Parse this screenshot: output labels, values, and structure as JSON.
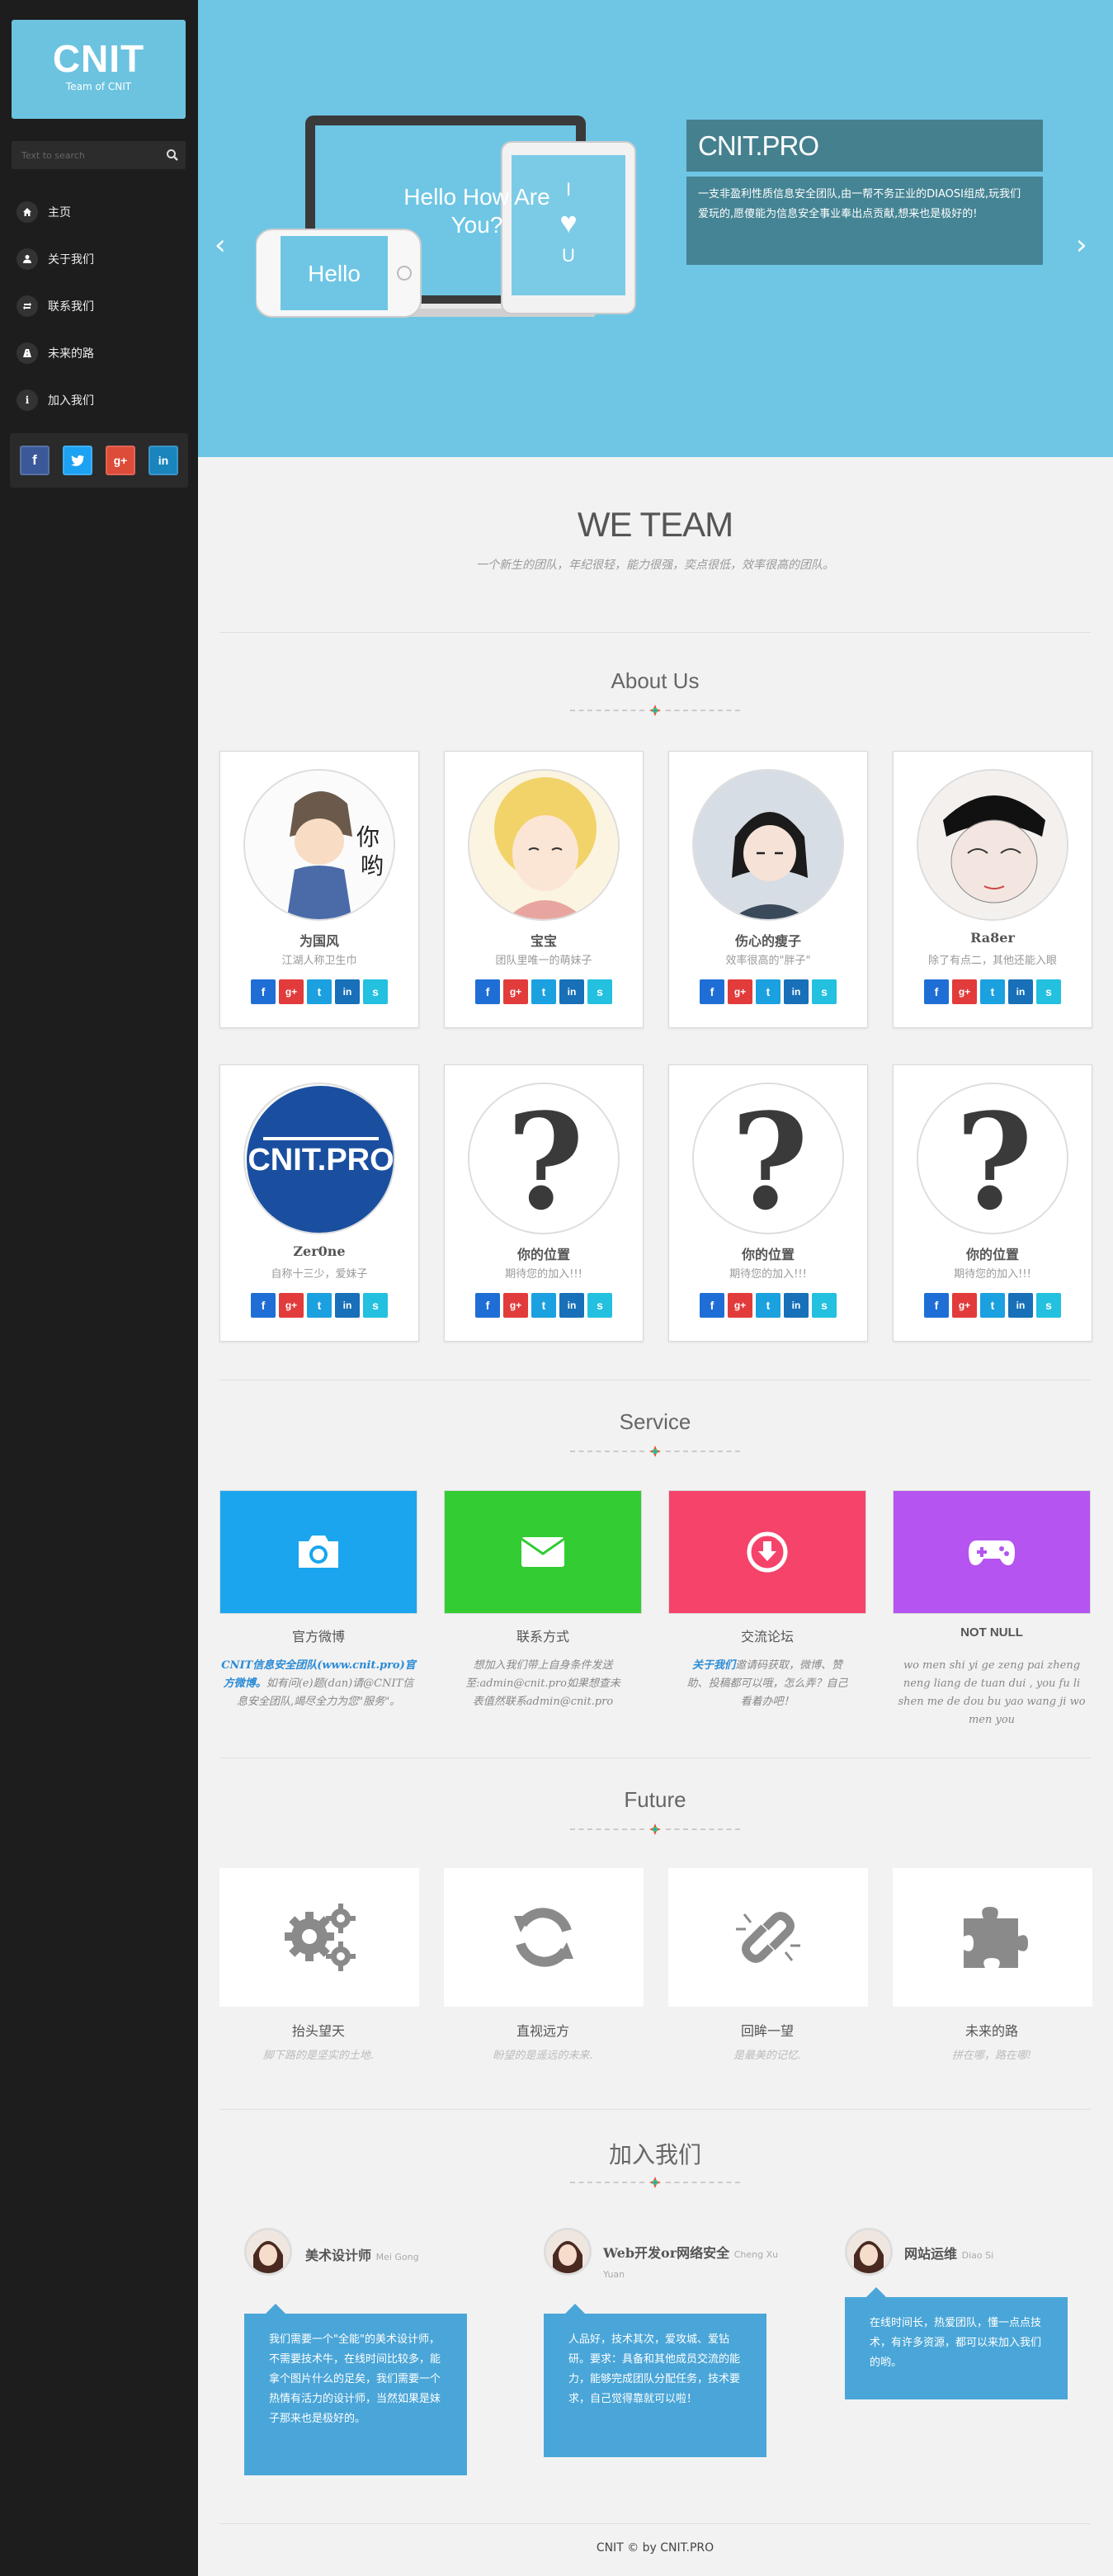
{
  "sidebar": {
    "logo_title": "CNIT",
    "logo_subtitle": "Team of CNIT",
    "search_placeholder": "Text to search",
    "nav": [
      {
        "label": "主页",
        "icon": "home-icon"
      },
      {
        "label": "关于我们",
        "icon": "user-icon"
      },
      {
        "label": "联系我们",
        "icon": "retweet-icon"
      },
      {
        "label": "未来的路",
        "icon": "road-icon"
      },
      {
        "label": "加入我们",
        "icon": "info-icon"
      }
    ],
    "social": [
      {
        "label": "f",
        "color": "#3b5998",
        "icon": "facebook-icon"
      },
      {
        "label": "t",
        "color": "#1da1f2",
        "icon": "twitter-icon"
      },
      {
        "label": "g+",
        "color": "#dd4b39",
        "icon": "google-plus-icon"
      },
      {
        "label": "in",
        "color": "#1a84bc",
        "icon": "linkedin-icon"
      }
    ]
  },
  "hero": {
    "prev_arrow": "‹",
    "next_arrow": "›",
    "laptop_text": "Hello How Are You?",
    "phone_text": "Hello",
    "tablet_lines": [
      "I",
      "♥",
      "U"
    ],
    "title": "CNIT.PRO",
    "text": "一支非盈利性质信息安全团队,由一帮不务正业的DIAOSI组成,玩我们爱玩的,愿傻能为信息安全事业奉出点贡献,想来也是极好的!"
  },
  "we_team": {
    "title": "WE TEAM",
    "subtitle": "一个新生的团队，年纪很轻，能力很强，奕点很低，效率很高的团队。"
  },
  "about": {
    "title": "About Us",
    "members": [
      {
        "name": "为国风",
        "desc": "江湖人称卫生巾",
        "avatar": "cartoon-swordsman-avatar"
      },
      {
        "name": "宝宝",
        "desc": "团队里唯一的萌妹子",
        "avatar": "blonde-girl-avatar"
      },
      {
        "name": "伤心的瘦子",
        "desc": "效率很高的\"胖子\"",
        "avatar": "cartoon-boy-avatar"
      },
      {
        "name": "Ra8er",
        "desc": "除了有点二，其他还能入眼",
        "avatar": "sketch-face-avatar"
      },
      {
        "name": "Zer0ne",
        "desc": "自称十三少，爱妹子",
        "avatar": "cnit-logo-avatar"
      },
      {
        "name": "你的位置",
        "desc": "期待您的加入!!!",
        "avatar": "question-mark-avatar"
      },
      {
        "name": "你的位置",
        "desc": "期待您的加入!!!",
        "avatar": "question-mark-avatar"
      },
      {
        "name": "你的位置",
        "desc": "期待您的加入!!!",
        "avatar": "question-mark-avatar"
      }
    ],
    "card_social": [
      {
        "label": "f",
        "color": "#1f6ed6"
      },
      {
        "label": "g+",
        "color": "#e23b3b"
      },
      {
        "label": "t",
        "color": "#1ba0e0"
      },
      {
        "label": "in",
        "color": "#1770b8"
      },
      {
        "label": "s",
        "color": "#23c0e0"
      }
    ]
  },
  "service": {
    "title": "Service",
    "items": [
      {
        "title": "官方微博",
        "color": "#1aa5ee",
        "icon": "camera-icon",
        "text_hl": "CNIT信息安全团队(www.cnit.pro)官方微博。",
        "text": "如有问(e)题(dan)请@CNIT信息安全团队,竭尽全力为您\"服务\"。"
      },
      {
        "title": "联系方式",
        "color": "#33cc33",
        "icon": "envelope-icon",
        "text_hl": "",
        "text": "想加入我们带上自身条件发送至:admin@cnit.pro如果想查未表值然联系admin@cnit.pro"
      },
      {
        "title": "交流论坛",
        "color": "#f5436a",
        "icon": "download-icon",
        "text_hl": "关于我们",
        "text": "邀请码获取，微博、赞助、投稿都可以哦，怎么弄？自己看着办吧！"
      },
      {
        "title": "NOT NULL",
        "color": "#b554f0",
        "icon": "gamepad-icon",
        "text_hl": "",
        "text": "wo men shi yi ge zeng pai zheng neng liang de tuan dui , you fu li shen me de dou bu yao wang ji wo men you"
      }
    ]
  },
  "future": {
    "title": "Future",
    "items": [
      {
        "title": "抬头望天",
        "sub": "脚下路的是坚实的土地.",
        "icon": "cogs-icon"
      },
      {
        "title": "直视远方",
        "sub": "盼望的是遥远的未来.",
        "icon": "refresh-icon"
      },
      {
        "title": "回眸一望",
        "sub": "是最美的记忆.",
        "icon": "broken-link-icon"
      },
      {
        "title": "未来的路",
        "sub": "拼在哪，路在哪!",
        "icon": "puzzle-icon"
      }
    ]
  },
  "join": {
    "title": "加入我们",
    "items": [
      {
        "role": "美术设计师",
        "name": "Mei Gong",
        "text": "我们需要一个\"全能\"的美术设计师，不需要技术牛，在线时间比较多，能拿个图片什么的足矣，我们需要一个热情有活力的设计师，当然如果是妹子那来也是极好的。"
      },
      {
        "role": "Web开发or网络安全",
        "name": "Cheng Xu Yuan",
        "text": "人品好，技术其次，爱攻城、爱钻研。要求：具备和其他成员交流的能力，能够完成团队分配任务，技术要求，自己觉得靠就可以啦！"
      },
      {
        "role": "网站运维",
        "name": "Diao Si",
        "text": "在线时间长，热爱团队，懂一点点技术，有许多资源，都可以来加入我们的哟。"
      }
    ]
  },
  "footer": {
    "text": "CNIT © by CNIT.PRO"
  }
}
